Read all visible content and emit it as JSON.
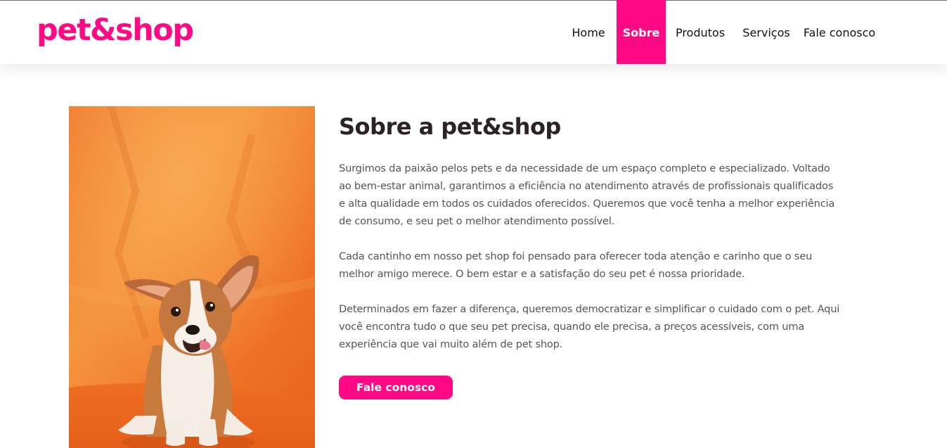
{
  "brand": {
    "logo_text": "pet&shop",
    "accent_color": "#ff0a84"
  },
  "nav": {
    "items": [
      {
        "label": "Home",
        "active": false
      },
      {
        "label": "Sobre",
        "active": true
      },
      {
        "label": "Produtos",
        "active": false
      },
      {
        "label": "Serviços",
        "active": false
      },
      {
        "label": "Fale conosco",
        "active": false
      }
    ]
  },
  "about": {
    "image_subject": "corgi puppy on orange background",
    "title": "Sobre a pet&shop",
    "paragraphs": [
      "Surgimos da paixão pelos pets e da necessidade de um espaço completo e especializado. Voltado ao bem-estar animal, garantimos a eficiência no atendimento através de profissionais qualificados e alta qualidade em todos os cuidados oferecidos. Queremos que você tenha a melhor experiência de consumo, e seu pet o melhor atendimento possível.",
      "Cada cantinho em nosso pet shop foi pensado para oferecer toda atenção e carinho que o seu melhor amigo merece. O bem estar e a satisfação do seu pet é nossa prioridade.",
      "Determinados em fazer a diferença, queremos democratizar e simplificar o cuidado com o pet. Aqui você encontra tudo o que seu pet precisa, quando ele precisa, a preços acessíveis, com uma experiência que vai muito além de pet shop."
    ],
    "cta_label": "Fale conosco"
  }
}
